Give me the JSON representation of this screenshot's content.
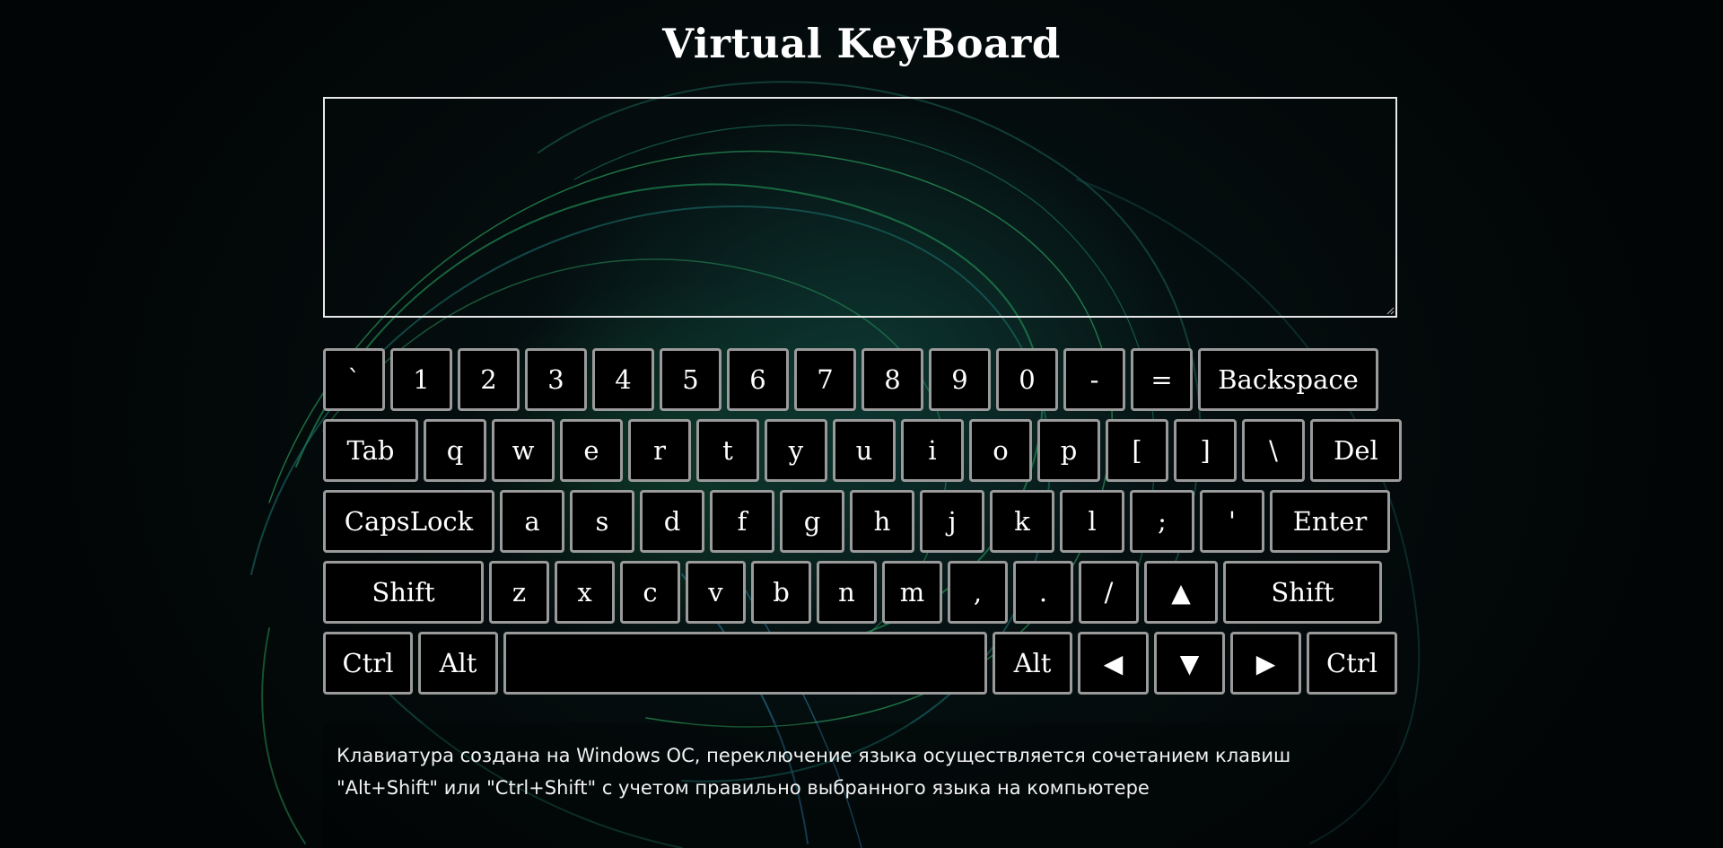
{
  "page": {
    "title": "Virtual KeyBoard",
    "textarea_value": "",
    "note": "Клавиатура создана на Windows ОС, переключение языка осуществляется сочетанием клавиш \"Alt+Shift\" или \"Ctrl+Shift\" с учетом правильно выбранного языка на компьютере"
  },
  "keyboard": {
    "rows": [
      [
        {
          "label": "`",
          "name": "key-backtick"
        },
        {
          "label": "1",
          "name": "key-1"
        },
        {
          "label": "2",
          "name": "key-2"
        },
        {
          "label": "3",
          "name": "key-3"
        },
        {
          "label": "4",
          "name": "key-4"
        },
        {
          "label": "5",
          "name": "key-5"
        },
        {
          "label": "6",
          "name": "key-6"
        },
        {
          "label": "7",
          "name": "key-7"
        },
        {
          "label": "8",
          "name": "key-8"
        },
        {
          "label": "9",
          "name": "key-9"
        },
        {
          "label": "0",
          "name": "key-0"
        },
        {
          "label": "-",
          "name": "key-minus"
        },
        {
          "label": "=",
          "name": "key-equals"
        },
        {
          "label": "Backspace",
          "name": "key-backspace"
        }
      ],
      [
        {
          "label": "Tab",
          "name": "key-tab"
        },
        {
          "label": "q",
          "name": "key-q"
        },
        {
          "label": "w",
          "name": "key-w"
        },
        {
          "label": "e",
          "name": "key-e"
        },
        {
          "label": "r",
          "name": "key-r"
        },
        {
          "label": "t",
          "name": "key-t"
        },
        {
          "label": "y",
          "name": "key-y"
        },
        {
          "label": "u",
          "name": "key-u"
        },
        {
          "label": "i",
          "name": "key-i"
        },
        {
          "label": "o",
          "name": "key-o"
        },
        {
          "label": "p",
          "name": "key-p"
        },
        {
          "label": "[",
          "name": "key-bracket-left"
        },
        {
          "label": "]",
          "name": "key-bracket-right"
        },
        {
          "label": "\\",
          "name": "key-backslash"
        },
        {
          "label": "Del",
          "name": "key-del"
        }
      ],
      [
        {
          "label": "CapsLock",
          "name": "key-capslock"
        },
        {
          "label": "a",
          "name": "key-a"
        },
        {
          "label": "s",
          "name": "key-s"
        },
        {
          "label": "d",
          "name": "key-d"
        },
        {
          "label": "f",
          "name": "key-f"
        },
        {
          "label": "g",
          "name": "key-g"
        },
        {
          "label": "h",
          "name": "key-h"
        },
        {
          "label": "j",
          "name": "key-j"
        },
        {
          "label": "k",
          "name": "key-k"
        },
        {
          "label": "l",
          "name": "key-l"
        },
        {
          "label": ";",
          "name": "key-semicolon"
        },
        {
          "label": "'",
          "name": "key-quote"
        },
        {
          "label": "Enter",
          "name": "key-enter"
        }
      ],
      [
        {
          "label": "Shift",
          "name": "key-shift-left"
        },
        {
          "label": "z",
          "name": "key-z"
        },
        {
          "label": "x",
          "name": "key-x"
        },
        {
          "label": "c",
          "name": "key-c"
        },
        {
          "label": "v",
          "name": "key-v"
        },
        {
          "label": "b",
          "name": "key-b"
        },
        {
          "label": "n",
          "name": "key-n"
        },
        {
          "label": "m",
          "name": "key-m"
        },
        {
          "label": ",",
          "name": "key-comma"
        },
        {
          "label": ".",
          "name": "key-period"
        },
        {
          "label": "/",
          "name": "key-slash"
        },
        {
          "label": "▲",
          "name": "key-arrow-up"
        },
        {
          "label": "Shift",
          "name": "key-shift-right"
        }
      ],
      [
        {
          "label": "Ctrl",
          "name": "key-ctrl-left"
        },
        {
          "label": "Alt",
          "name": "key-alt-left"
        },
        {
          "label": "",
          "name": "key-space"
        },
        {
          "label": "Alt",
          "name": "key-alt-right"
        },
        {
          "label": "◀",
          "name": "key-arrow-left"
        },
        {
          "label": "▼",
          "name": "key-arrow-down"
        },
        {
          "label": "▶",
          "name": "key-arrow-right"
        },
        {
          "label": "Ctrl",
          "name": "key-ctrl-right"
        }
      ]
    ]
  }
}
